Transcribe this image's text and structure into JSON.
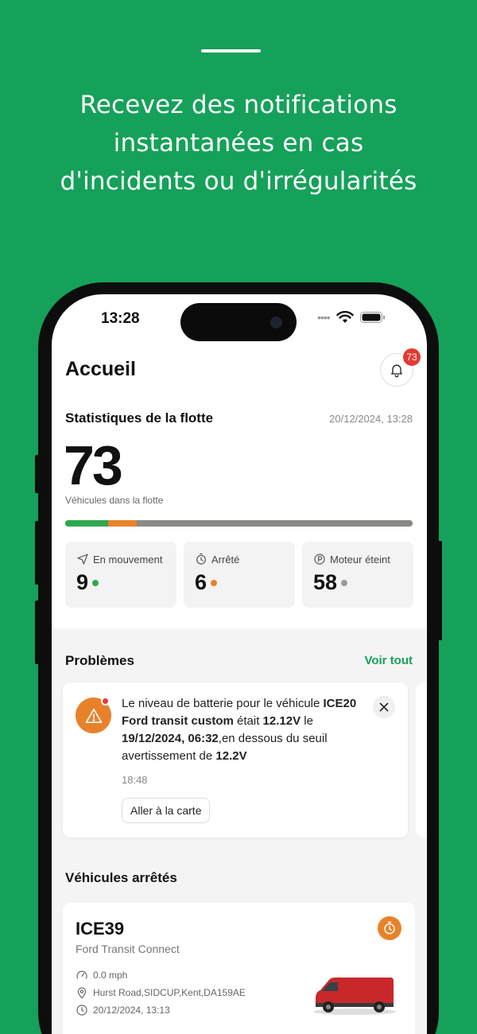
{
  "headline": {
    "line1": "Recevez des notifications",
    "line2": "instantanées en cas",
    "line3": "d'incidents ou d'irrégularités"
  },
  "status_bar": {
    "time": "13:28",
    "dots": "••••"
  },
  "header": {
    "title": "Accueil",
    "notification_count": "73"
  },
  "fleet_stats": {
    "title": "Statistiques de la flotte",
    "date": "20/12/2024, 13:28",
    "total": "73",
    "total_label": "Véhicules dans la flotte",
    "bar_segments": [
      {
        "name": "En mouvement",
        "value": 9,
        "color": "#2fa84f"
      },
      {
        "name": "Arrêté",
        "value": 6,
        "color": "#e8822a"
      },
      {
        "name": "Moteur éteint",
        "value": 58,
        "color": "#8a8a86"
      }
    ],
    "cards": [
      {
        "label": "En mouvement",
        "value": "9",
        "icon": "navigation-arrow-icon",
        "color": "#2fa84f"
      },
      {
        "label": "Arrêté",
        "value": "6",
        "icon": "stopwatch-icon",
        "color": "#e8822a"
      },
      {
        "label": "Moteur éteint",
        "value": "58",
        "icon": "parking-icon",
        "color": "#9a9a9a"
      }
    ]
  },
  "problems": {
    "title": "Problèmes",
    "view_all": "Voir tout",
    "alert": {
      "t1": "Le niveau de batterie pour le véhicule ",
      "vehicle": "ICE20 Ford transit custom",
      "t2": " était ",
      "voltage": "12.12V",
      "t3": " le ",
      "datetime": "19/12/2024, 06:32",
      "t4": ",en dessous du seuil avertissement de ",
      "threshold": "12.2V",
      "time": "18:48",
      "button": "Aller à la carte"
    }
  },
  "stopped": {
    "title": "Véhicules arrêtés",
    "vehicle": {
      "name": "ICE39",
      "model": "Ford Transit Connect",
      "speed": "0.0 mph",
      "address": "Hurst Road,SIDCUP,Kent,DA159AE",
      "datetime": "20/12/2024, 13:13"
    }
  },
  "colors": {
    "brand_green": "#15a159",
    "orange": "#e8822a",
    "red": "#e53935"
  }
}
